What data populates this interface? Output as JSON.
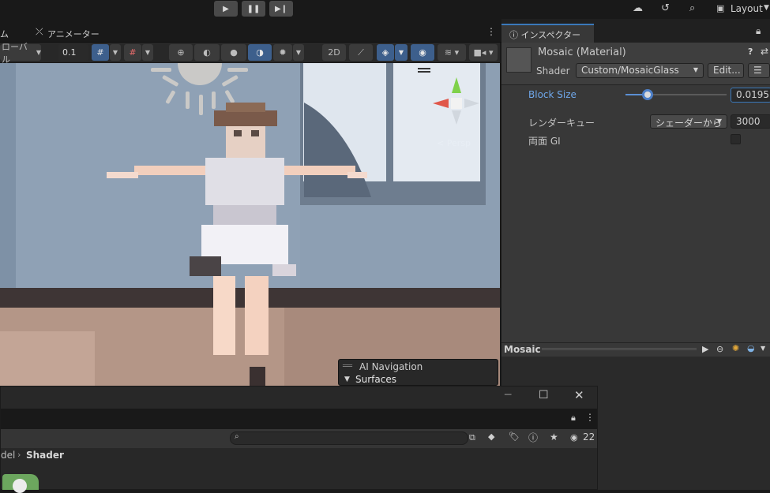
{
  "toolbar": {
    "play_icon": "play-icon",
    "pause_icon": "pause-icon",
    "step_icon": "step-icon",
    "layout_label": "Layout"
  },
  "tabs": {
    "left_partial": "ム",
    "animator": "アニメーター"
  },
  "scene_toolbar": {
    "global_label": "ローバル",
    "snap_value": "0.1"
  },
  "scene": {
    "persp_label": "< Persp",
    "ai_nav_title": "AI Navigation",
    "ai_nav_surfaces": "Surfaces"
  },
  "inspector": {
    "tab_label": "インスペクター",
    "material_title": "Mosaic (Material)",
    "shader_label": "Shader",
    "shader_value": "Custom/MosaicGlass",
    "edit_button": "Edit...",
    "block_size_label": "Block Size",
    "block_size_value": "0.0195",
    "block_size_level": 0.22,
    "render_queue_label": "レンダーキュー",
    "render_queue_source": "シェーダーから",
    "render_queue_value": "3000",
    "double_gi_label": "両面 GI",
    "double_gi_checked": false
  },
  "preview": {
    "title": "Mosaic"
  },
  "project": {
    "breadcrumb_prev": "del",
    "breadcrumb_current": "Shader",
    "visible_count": "22"
  },
  "colors": {
    "accent": "#3a79bb",
    "slider_active": "#5b8fd4",
    "panel": "#383838"
  }
}
